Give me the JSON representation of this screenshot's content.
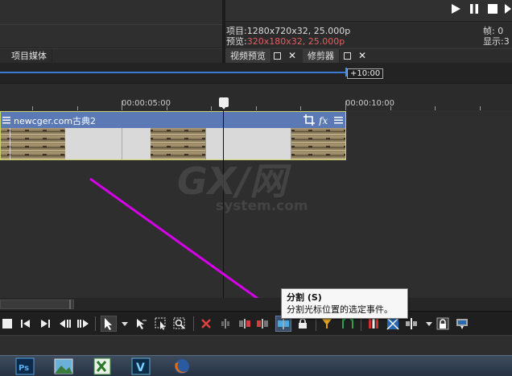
{
  "preview": {
    "project_label": "项目:",
    "project_value": "1280x720x32, 25.000p",
    "preview_label": "预览:",
    "preview_value": "320x180x32, 25.000p",
    "frame_label": "帧:",
    "frame_value": "0",
    "display_label": "显示:",
    "display_value": "3"
  },
  "tabs": {
    "left": [
      {
        "label": "项目媒体"
      }
    ],
    "right": [
      {
        "label": "视频预览"
      },
      {
        "label": "修剪器"
      }
    ]
  },
  "overview": {
    "marker_label": "+10:00"
  },
  "ruler": {
    "labels": [
      "00:00:05:00",
      "00:00:10:00"
    ]
  },
  "clip": {
    "title": "newcger.com古典2"
  },
  "tooltip": {
    "title": "分割 (S)",
    "description": "分割光标位置的选定事件。"
  },
  "watermark": {
    "big": "GX/网",
    "small": "system.com"
  },
  "colors": {
    "accent": "#3a7bd5",
    "clip_header": "#5a79b5",
    "clip_border": "#c8d46a",
    "arrow": "#d400e8"
  }
}
